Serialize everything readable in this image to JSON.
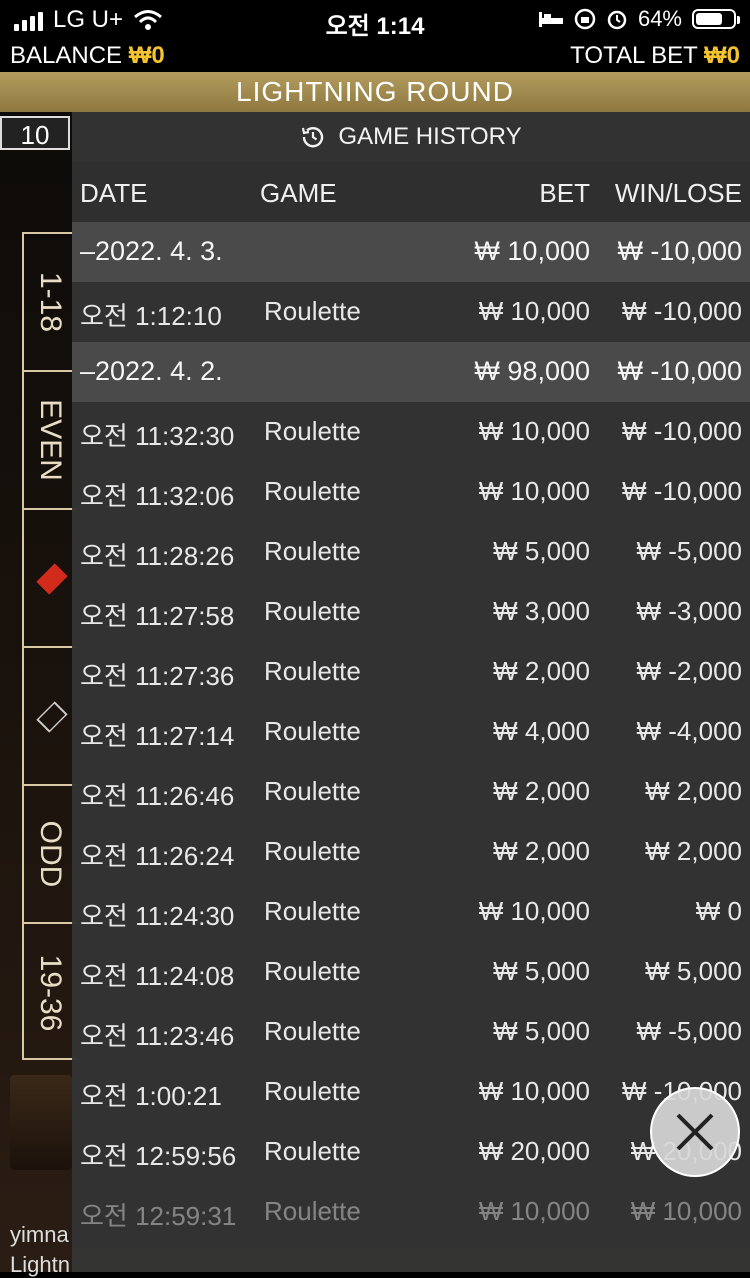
{
  "status": {
    "carrier": "LG U+",
    "time": "오전 1:14",
    "battery": "64%"
  },
  "info": {
    "balance_label": "BALANCE",
    "balance_value": "₩0",
    "total_bet_label": "TOTAL BET",
    "total_bet_value": "₩0"
  },
  "banner": "LIGHTNING ROUND",
  "background": {
    "number_chip": "10",
    "side_cells": [
      "1-18",
      "EVEN",
      "",
      "",
      "ODD",
      "19-36"
    ],
    "footer_user": "yimna",
    "footer_game": "Lightn"
  },
  "history": {
    "title": "GAME HISTORY",
    "headers": {
      "date": "DATE",
      "game": "GAME",
      "bet": "BET",
      "win": "WIN/LOSE"
    },
    "rows": [
      {
        "type": "date",
        "date": "–2022. 4. 3.",
        "game": "",
        "bet": "₩ 10,000",
        "win": "₩ -10,000"
      },
      {
        "type": "entry",
        "date": "오전 1:12:10",
        "game": "Roulette",
        "bet": "₩ 10,000",
        "win": "₩ -10,000"
      },
      {
        "type": "date",
        "date": "–2022. 4. 2.",
        "game": "",
        "bet": "₩ 98,000",
        "win": "₩ -10,000"
      },
      {
        "type": "entry",
        "date": "오전 11:32:30",
        "game": "Roulette",
        "bet": "₩ 10,000",
        "win": "₩ -10,000"
      },
      {
        "type": "entry",
        "date": "오전 11:32:06",
        "game": "Roulette",
        "bet": "₩ 10,000",
        "win": "₩ -10,000"
      },
      {
        "type": "entry",
        "date": "오전 11:28:26",
        "game": "Roulette",
        "bet": "₩ 5,000",
        "win": "₩ -5,000"
      },
      {
        "type": "entry",
        "date": "오전 11:27:58",
        "game": "Roulette",
        "bet": "₩ 3,000",
        "win": "₩ -3,000"
      },
      {
        "type": "entry",
        "date": "오전 11:27:36",
        "game": "Roulette",
        "bet": "₩ 2,000",
        "win": "₩ -2,000"
      },
      {
        "type": "entry",
        "date": "오전 11:27:14",
        "game": "Roulette",
        "bet": "₩ 4,000",
        "win": "₩ -4,000"
      },
      {
        "type": "entry",
        "date": "오전 11:26:46",
        "game": "Roulette",
        "bet": "₩ 2,000",
        "win": "₩ 2,000"
      },
      {
        "type": "entry",
        "date": "오전 11:26:24",
        "game": "Roulette",
        "bet": "₩ 2,000",
        "win": "₩ 2,000"
      },
      {
        "type": "entry",
        "date": "오전 11:24:30",
        "game": "Roulette",
        "bet": "₩ 10,000",
        "win": "₩ 0"
      },
      {
        "type": "entry",
        "date": "오전 11:24:08",
        "game": "Roulette",
        "bet": "₩ 5,000",
        "win": "₩ 5,000"
      },
      {
        "type": "entry",
        "date": "오전 11:23:46",
        "game": "Roulette",
        "bet": "₩ 5,000",
        "win": "₩ -5,000"
      },
      {
        "type": "entry",
        "date": "오전 1:00:21",
        "game": "Roulette",
        "bet": "₩ 10,000",
        "win": "₩ -10,000"
      },
      {
        "type": "entry",
        "date": "오전 12:59:56",
        "game": "Roulette",
        "bet": "₩ 20,000",
        "win": "₩ 20,000"
      },
      {
        "type": "entry",
        "date": "오전 12:59:31",
        "game": "Roulette",
        "bet": "₩ 10,000",
        "win": "₩ 10,000"
      }
    ]
  }
}
